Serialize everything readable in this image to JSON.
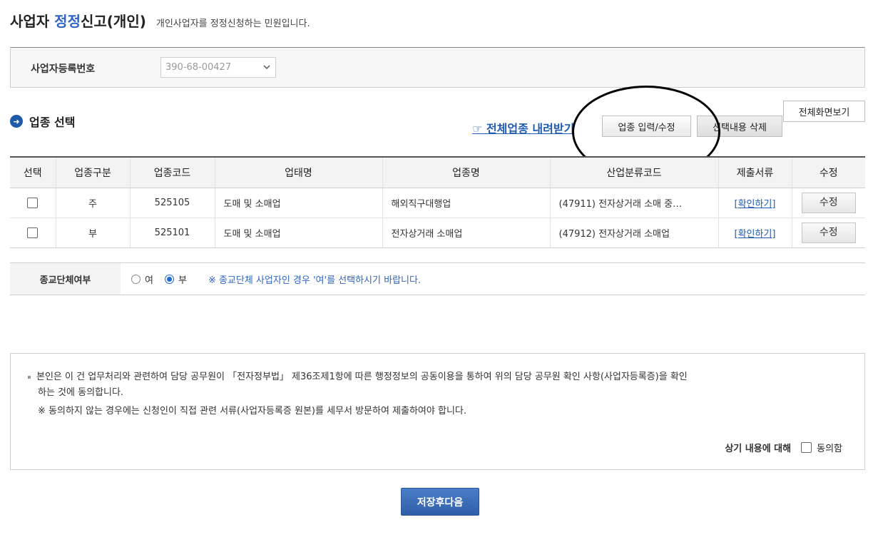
{
  "header": {
    "title_prefix": "사업자 ",
    "title_accent": "정정",
    "title_suffix": "신고(개인)",
    "subtitle": "개인사업자를 정정신청하는 민원입니다."
  },
  "registration": {
    "label": "사업자등록번호",
    "value": "390-68-00427"
  },
  "section": {
    "title": "업종 선택",
    "download_link": "☞ 전체업종 내려받기",
    "input_button": "업종 입력/수정",
    "delete_button": "선택내용 삭제",
    "fullscreen_button": "전체화면보기"
  },
  "table": {
    "headers": [
      "선택",
      "업종구분",
      "업종코드",
      "업태명",
      "업종명",
      "산업분류코드",
      "제출서류",
      "수정"
    ],
    "rows": [
      {
        "type": "주",
        "code": "525105",
        "business": "도매 및 소매업",
        "industry": "해외직구대행업",
        "class_code": "(47911) 전자상거래 소매 중…",
        "docs": "[확인하기]",
        "edit": "수정"
      },
      {
        "type": "부",
        "code": "525101",
        "business": "도매 및 소매업",
        "industry": "전자상거래 소매업",
        "class_code": "(47912) 전자상거래 소매업",
        "docs": "[확인하기]",
        "edit": "수정"
      }
    ]
  },
  "religion": {
    "label": "종교단체여부",
    "option_yes": "여",
    "option_no": "부",
    "selected": "부",
    "note": "※ 종교단체 사업자인 경우 '여'를 선택하시기 바랍니다."
  },
  "consent": {
    "line1": "본인은 이 건 업무처리와 관련하여 담당 공무원이 「전자정부법」 제36조제1항에 따른 행정정보의 공동이용을 통하여 위의 담당 공무원 확인 사항(사업자등록증)을 확인",
    "line2": "하는 것에 동의합니다.",
    "note": "※  동의하지 않는 경우에는 신청인이 직접 관련 서류(사업자등록증 원본)를 세무서 방문하여 제출하여야 합니다.",
    "question": "상기 내용에 대해",
    "agree_label": "동의함"
  },
  "footer": {
    "save_button": "저장후다음"
  }
}
